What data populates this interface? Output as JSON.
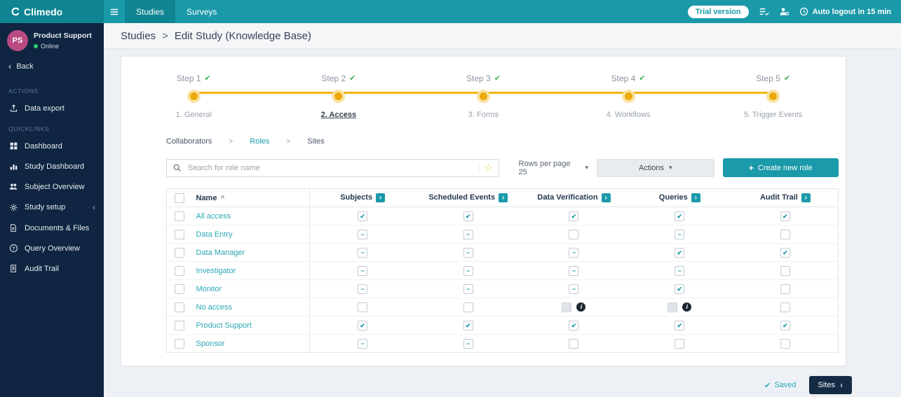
{
  "topbar": {
    "logo_text": "Climedo",
    "tabs": [
      {
        "label": "Studies",
        "active": true
      },
      {
        "label": "Surveys",
        "active": false
      }
    ],
    "trial_badge": "Trial version",
    "auto_logout": "Auto logout in 15 min"
  },
  "sidebar": {
    "user": {
      "initials": "PS",
      "name": "Product Support",
      "status": "Online"
    },
    "back_label": "Back",
    "sections": [
      {
        "title": "ACTIONS",
        "items": [
          {
            "label": "Data export",
            "icon": "data-export-icon"
          }
        ]
      },
      {
        "title": "QUICKLINKS",
        "items": [
          {
            "label": "Dashboard",
            "icon": "dashboard-icon"
          },
          {
            "label": "Study Dashboard",
            "icon": "study-dashboard-icon"
          },
          {
            "label": "Subject Overview",
            "icon": "subject-overview-icon"
          },
          {
            "label": "Study setup",
            "icon": "study-setup-gear-icon",
            "expandable": true
          },
          {
            "label": "Documents & Files",
            "icon": "documents-icon"
          },
          {
            "label": "Query Overview",
            "icon": "query-overview-icon"
          },
          {
            "label": "Audit Trail",
            "icon": "audit-trail-icon"
          }
        ]
      }
    ]
  },
  "breadcrumb": {
    "parent": "Studies",
    "separator": ">",
    "current": "Edit Study (Knowledge Base)"
  },
  "stepper": {
    "steps": [
      {
        "title": "Step 1",
        "label": "1. General",
        "complete": true,
        "active": false
      },
      {
        "title": "Step 2",
        "label": "2. Access",
        "complete": true,
        "active": true
      },
      {
        "title": "Step 3",
        "label": "3. Forms",
        "complete": true,
        "active": false
      },
      {
        "title": "Step 4",
        "label": "4. Workflows",
        "complete": true,
        "active": false
      },
      {
        "title": "Step 5",
        "label": "5. Trigger Events",
        "complete": true,
        "active": false
      }
    ]
  },
  "subnav": {
    "separator": ">",
    "items": [
      {
        "label": "Collaborators",
        "active": false
      },
      {
        "label": "Roles",
        "active": true
      },
      {
        "label": "Sites",
        "active": false
      }
    ]
  },
  "toolbar": {
    "search_placeholder": "Search for role name",
    "rows_per_page_label": "Rows per page 25",
    "actions_label": "Actions",
    "create_role_label": "Create new role"
  },
  "table": {
    "columns": [
      {
        "label": "Name",
        "sortable": true,
        "badge": false
      },
      {
        "label": "Subjects",
        "badge": true
      },
      {
        "label": "Scheduled Events",
        "badge": true
      },
      {
        "label": "Data Verification",
        "badge": true
      },
      {
        "label": "Queries",
        "badge": true
      },
      {
        "label": "Audit Trail",
        "badge": true
      }
    ],
    "rows": [
      {
        "name": "All access",
        "permissions": [
          "checked",
          "checked",
          "checked",
          "checked",
          "checked"
        ]
      },
      {
        "name": "Data Entry",
        "permissions": [
          "indeterminate",
          "indeterminate",
          "unchecked",
          "indeterminate",
          "unchecked"
        ]
      },
      {
        "name": "Data Manager",
        "permissions": [
          "indeterminate",
          "indeterminate",
          "indeterminate",
          "checked",
          "checked"
        ]
      },
      {
        "name": "Investigator",
        "permissions": [
          "indeterminate",
          "indeterminate",
          "indeterminate",
          "indeterminate",
          "unchecked"
        ]
      },
      {
        "name": "Monitor",
        "permissions": [
          "indeterminate",
          "indeterminate",
          "indeterminate",
          "checked",
          "unchecked"
        ]
      },
      {
        "name": "No access",
        "permissions": [
          "unchecked",
          "unchecked",
          "disabled-info",
          "disabled-info",
          "unchecked"
        ]
      },
      {
        "name": "Product Support",
        "permissions": [
          "checked",
          "checked",
          "checked",
          "checked",
          "checked"
        ]
      },
      {
        "name": "Sponsor",
        "permissions": [
          "indeterminate",
          "indeterminate",
          "unchecked",
          "unchecked",
          "unchecked"
        ]
      }
    ]
  },
  "footer": {
    "saved_label": "Saved",
    "next_label": "Sites"
  },
  "colors": {
    "teal": "#1b9aaa",
    "navy": "#0f2541",
    "gold": "#f0b429",
    "green": "#3cb054",
    "avatar_pink": "#b94a82"
  }
}
